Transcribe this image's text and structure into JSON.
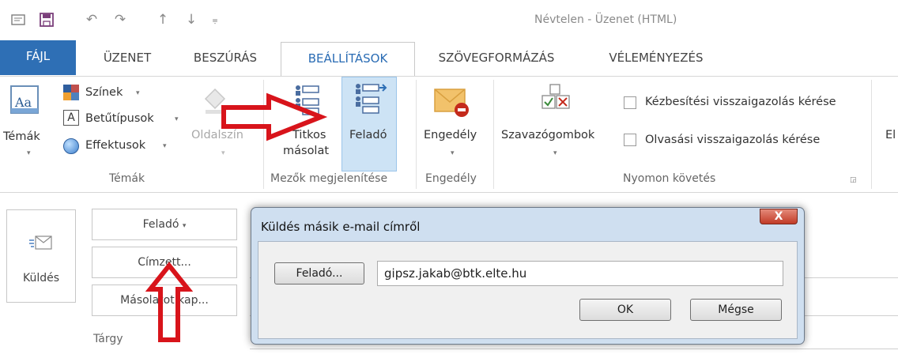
{
  "window": {
    "title": "Névtelen - Üzenet (HTML)"
  },
  "quick_access": [
    "message-icon",
    "save-icon",
    "undo-icon",
    "redo-icon",
    "up-icon",
    "down-icon",
    "customize-icon"
  ],
  "tabs": [
    {
      "label": "FÁJL"
    },
    {
      "label": "ÜZENET"
    },
    {
      "label": "BESZÚRÁS"
    },
    {
      "label": "BEÁLLÍTÁSOK"
    },
    {
      "label": "SZÖVEGFORMÁZÁS"
    },
    {
      "label": "VÉLEMÉNYEZÉS"
    }
  ],
  "ribbon": {
    "temak": {
      "button": "Témák",
      "colors": "Színek",
      "fonts": "Betűtípusok",
      "effects": "Effektusok",
      "page_color": "Oldalszín",
      "group": "Témák"
    },
    "fields": {
      "bcc_line1": "Titkos",
      "bcc_line2": "másolat",
      "from": "Feladó",
      "group": "Mezők megjelenítése"
    },
    "permission": {
      "button": "Engedély",
      "group": "Engedély"
    },
    "tracking": {
      "voting": "Szavazógombok",
      "delivery_receipt": "Kézbesítési visszaigazolás kérése",
      "read_receipt": "Olvasási visszaigazolás kérése",
      "group": "Nyomon követés"
    },
    "cut_off_label": "El"
  },
  "compose": {
    "send": "Küldés",
    "from_button": "Feladó",
    "to_button": "Címzett...",
    "cc_button": "Másolatot kap...",
    "subject_label": "Tárgy"
  },
  "dialog": {
    "title": "Küldés másik e-mail címről",
    "close": "X",
    "from_button": "Feladó...",
    "from_value": "gipsz.jakab@btk.elte.hu",
    "ok": "OK",
    "cancel": "Mégse"
  },
  "colors": {
    "accent": "#2e6fb5",
    "arrow": "#d8141b",
    "selected": "#cde3f5"
  }
}
